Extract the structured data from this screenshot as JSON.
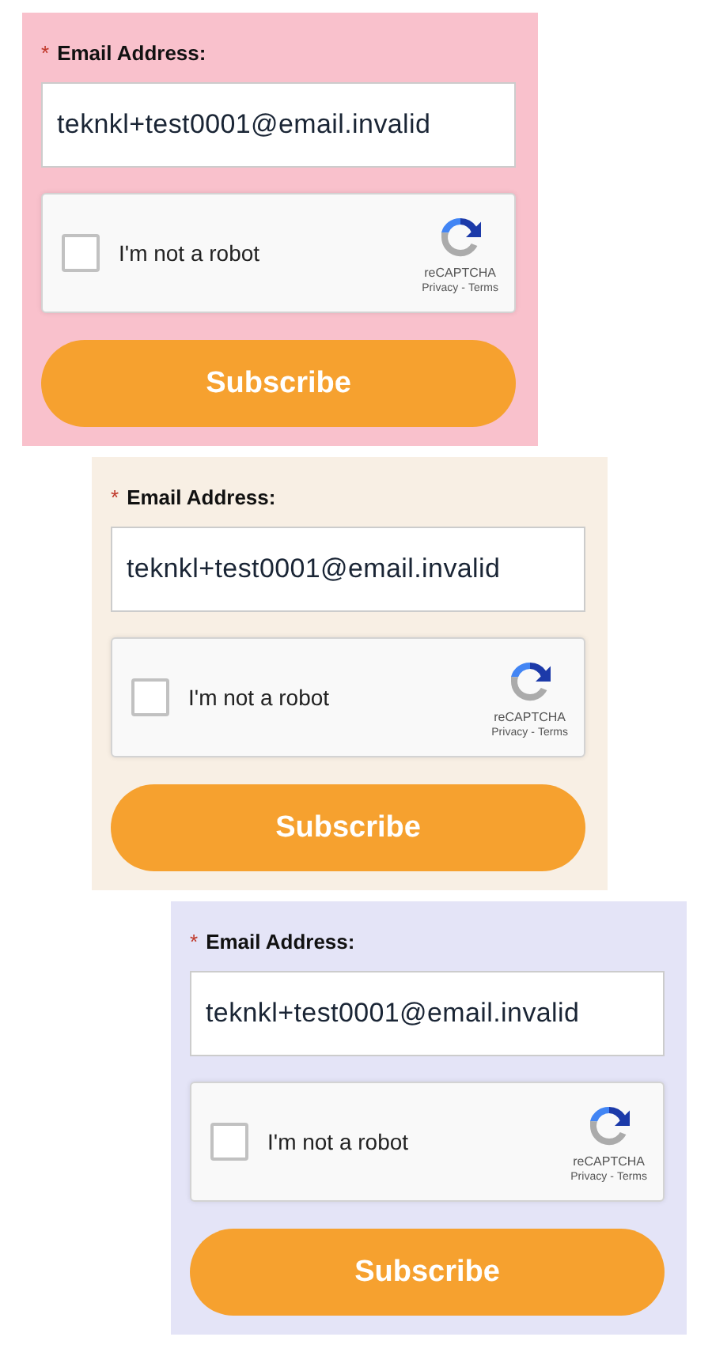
{
  "forms": [
    {
      "color": "#f9c1cc",
      "required_mark": "*",
      "label": "Email Address:",
      "email": "teknkl+test0001@email.invalid",
      "captcha": {
        "checked": false,
        "label": "I'm not a robot",
        "brand": "reCAPTCHA",
        "privacy": "Privacy",
        "separator": "-",
        "terms": "Terms"
      },
      "button": "Subscribe"
    },
    {
      "color": "#f8efe4",
      "required_mark": "*",
      "label": "Email Address:",
      "email": "teknkl+test0001@email.invalid",
      "captcha": {
        "checked": false,
        "label": "I'm not a robot",
        "brand": "reCAPTCHA",
        "privacy": "Privacy",
        "separator": "-",
        "terms": "Terms"
      },
      "button": "Subscribe"
    },
    {
      "color": "#e4e4f7",
      "required_mark": "*",
      "label": "Email Address:",
      "email": "teknkl+test0001@email.invalid",
      "captcha": {
        "checked": false,
        "label": "I'm not a robot",
        "brand": "reCAPTCHA",
        "privacy": "Privacy",
        "separator": "-",
        "terms": "Terms"
      },
      "button": "Subscribe"
    }
  ]
}
